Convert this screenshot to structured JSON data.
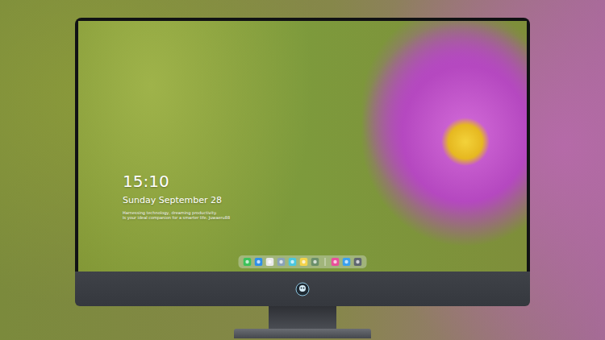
{
  "lock_screen": {
    "time": "15:10",
    "date": "Sunday September 28",
    "caption_lines": [
      "Harnessing technology, dreaming productivity.",
      "Is your ideal companion for a smarter life. Juwaeru88"
    ]
  }
}
